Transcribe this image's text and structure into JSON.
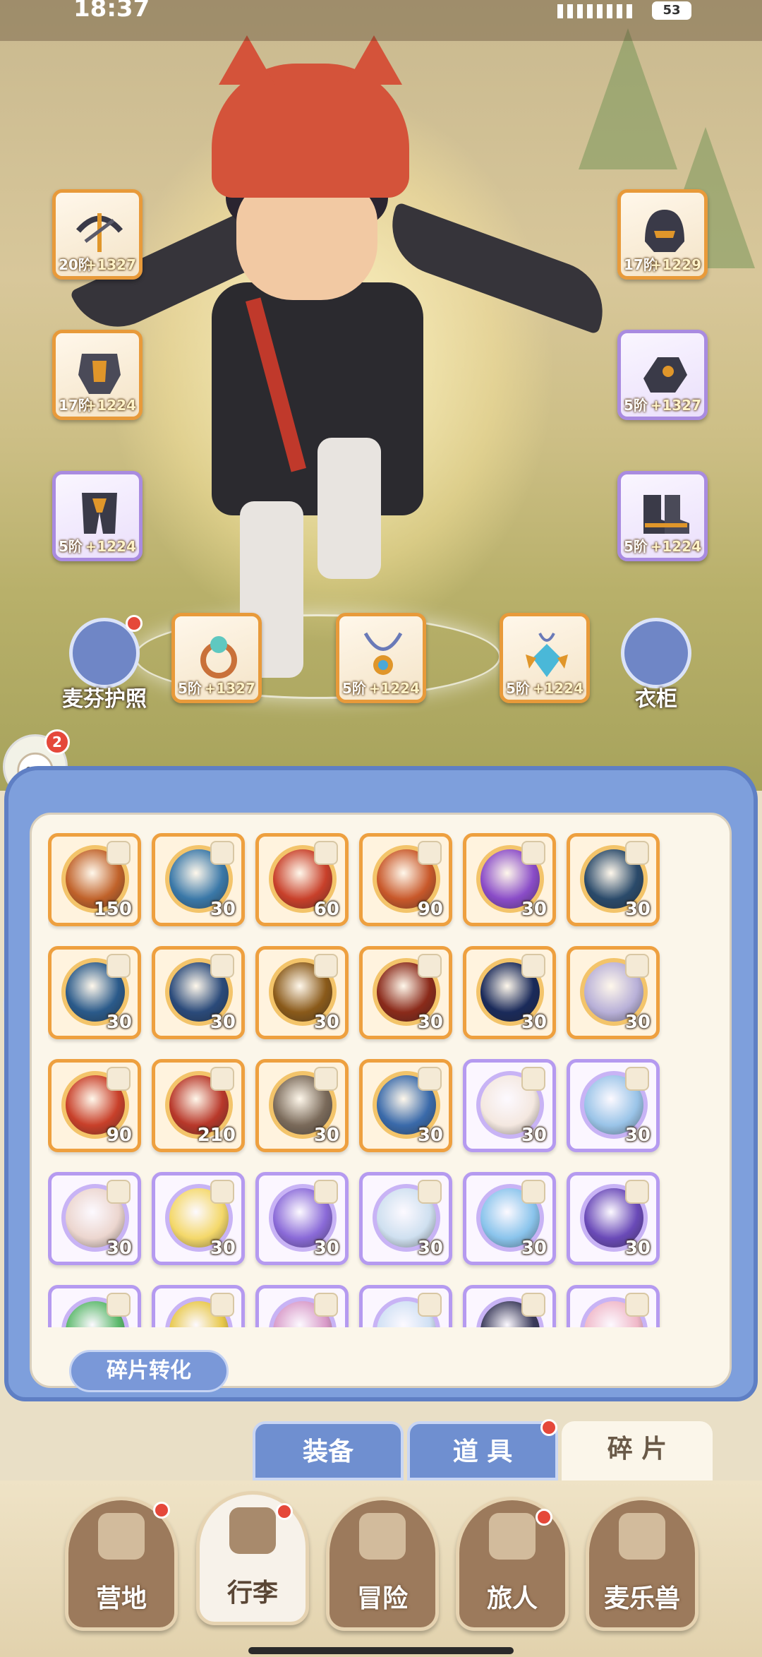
{
  "status_bar": {
    "time": "18:37",
    "battery": "53"
  },
  "left_slots": [
    {
      "tier": "20阶",
      "bonus": "+1327",
      "color": "#e89a3a",
      "icon": "crossbow-icon"
    },
    {
      "tier": "17阶",
      "bonus": "+1224",
      "color": "#e89a3a",
      "icon": "chest-armor-icon"
    },
    {
      "tier": "5阶",
      "bonus": "+1224",
      "color": "#a98be0",
      "icon": "leg-armor-icon"
    }
  ],
  "right_slots": [
    {
      "tier": "17阶",
      "bonus": "+1229",
      "color": "#e89a3a",
      "icon": "helmet-icon"
    },
    {
      "tier": "5阶",
      "bonus": "+1327",
      "color": "#a98be0",
      "icon": "gauntlet-icon"
    },
    {
      "tier": "5阶",
      "bonus": "+1224",
      "color": "#a98be0",
      "icon": "boots-icon"
    }
  ],
  "accessory_slots": [
    {
      "tier": "5阶",
      "bonus": "+1327",
      "icon": "ring-icon"
    },
    {
      "tier": "5阶",
      "bonus": "+1224",
      "icon": "necklace-icon"
    },
    {
      "tier": "5阶",
      "bonus": "+1224",
      "icon": "amulet-icon"
    }
  ],
  "passport_label": "麦芬护照",
  "wardrobe_label": "衣柜",
  "pet_badge_count": "2",
  "fragments": [
    {
      "qty": "150",
      "rarity": "orange",
      "color": "#c0622a"
    },
    {
      "qty": "30",
      "rarity": "orange",
      "color": "#3a78a8"
    },
    {
      "qty": "60",
      "rarity": "orange",
      "color": "#c8402a"
    },
    {
      "qty": "90",
      "rarity": "orange",
      "color": "#c8582a"
    },
    {
      "qty": "30",
      "rarity": "orange",
      "color": "#8a4cc8"
    },
    {
      "qty": "30",
      "rarity": "orange",
      "color": "#2a4a6a"
    },
    {
      "qty": "30",
      "rarity": "orange",
      "color": "#2a5a8a"
    },
    {
      "qty": "30",
      "rarity": "orange",
      "color": "#2a4a7a"
    },
    {
      "qty": "30",
      "rarity": "orange",
      "color": "#8a5a1a"
    },
    {
      "qty": "30",
      "rarity": "orange",
      "color": "#8a2a1a"
    },
    {
      "qty": "30",
      "rarity": "orange",
      "color": "#1a2a5a"
    },
    {
      "qty": "30",
      "rarity": "orange",
      "color": "#b8b0d8"
    },
    {
      "qty": "90",
      "rarity": "orange",
      "color": "#c8402a"
    },
    {
      "qty": "210",
      "rarity": "orange",
      "color": "#b8382a"
    },
    {
      "qty": "30",
      "rarity": "orange",
      "color": "#7a6a5a"
    },
    {
      "qty": "30",
      "rarity": "orange",
      "color": "#3a6aaa"
    },
    {
      "qty": "30",
      "rarity": "purple",
      "color": "#f4e8e0"
    },
    {
      "qty": "30",
      "rarity": "purple",
      "color": "#9ac4e8"
    },
    {
      "qty": "30",
      "rarity": "purple",
      "color": "#ecd6cf"
    },
    {
      "qty": "30",
      "rarity": "purple",
      "color": "#f4d86a"
    },
    {
      "qty": "30",
      "rarity": "purple",
      "color": "#8a6ad8"
    },
    {
      "qty": "30",
      "rarity": "purple",
      "color": "#cfe0f0"
    },
    {
      "qty": "30",
      "rarity": "purple",
      "color": "#8ac4ec"
    },
    {
      "qty": "30",
      "rarity": "purple",
      "color": "#6a4ab8"
    },
    {
      "qty": "",
      "rarity": "purple",
      "color": "#5ab86a"
    },
    {
      "qty": "",
      "rarity": "purple",
      "color": "#e8c84a"
    },
    {
      "qty": "",
      "rarity": "purple",
      "color": "#d89ac8"
    },
    {
      "qty": "",
      "rarity": "purple",
      "color": "#cfe0f4"
    },
    {
      "qty": "",
      "rarity": "purple",
      "color": "#3a3a5a"
    },
    {
      "qty": "",
      "rarity": "purple",
      "color": "#f0b8c8"
    }
  ],
  "convert_button": "碎片转化",
  "sub_tabs": [
    {
      "label": "装备",
      "active": false
    },
    {
      "label": "道 具",
      "active": false,
      "dot": true
    },
    {
      "label": "碎 片",
      "active": true
    }
  ],
  "nav": [
    {
      "label": "营地",
      "icon": "castle-icon",
      "dot": true,
      "active": false
    },
    {
      "label": "行李",
      "icon": "luggage-icon",
      "dot": true,
      "active": true
    },
    {
      "label": "冒险",
      "icon": "crossed-swords-icon",
      "dot": false,
      "active": false
    },
    {
      "label": "旅人",
      "icon": "traveler-icon",
      "dot": true,
      "active": false
    },
    {
      "label": "麦乐兽",
      "icon": "cat-icon",
      "dot": false,
      "active": false
    }
  ]
}
